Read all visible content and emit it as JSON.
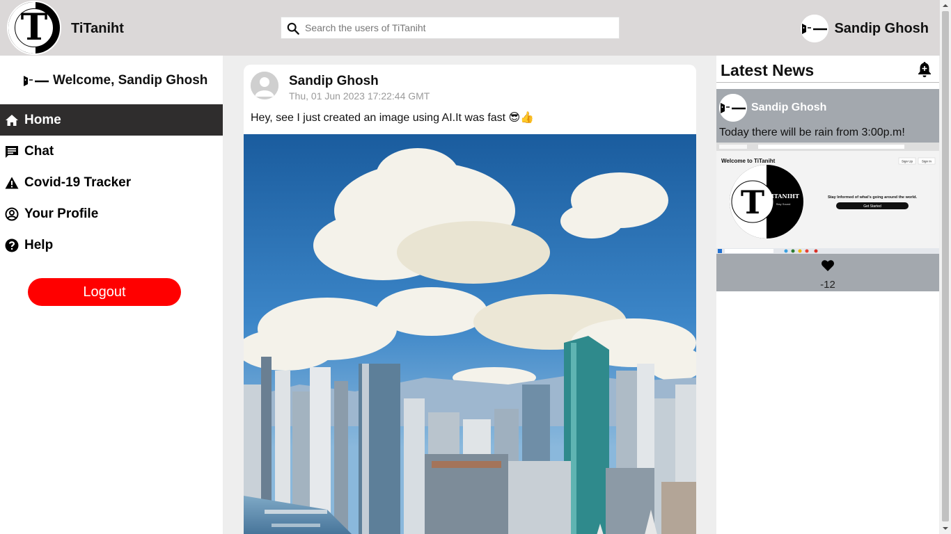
{
  "header": {
    "logo_letter": "T",
    "brand": "TiTaniht",
    "search_placeholder": "Search the users of TiTaniht",
    "user_name": "Sandip Ghosh"
  },
  "sidebar": {
    "welcome": "Welcome, Sandip Ghosh",
    "items": [
      {
        "label": "Home",
        "icon": "home-icon",
        "active": true
      },
      {
        "label": "Chat",
        "icon": "chat-icon",
        "active": false
      },
      {
        "label": "Covid-19 Tracker",
        "icon": "warning-icon",
        "active": false
      },
      {
        "label": "Your Profile",
        "icon": "profile-icon",
        "active": false
      },
      {
        "label": "Help",
        "icon": "help-icon",
        "active": false
      }
    ],
    "logout_label": "Logout"
  },
  "post": {
    "author": "Sandip Ghosh",
    "timestamp": "Thu, 01 Jun 2023 17:22:44 GMT",
    "text": "Hey, see I just created an image using AI.It was fast 😎👍"
  },
  "news": {
    "title": "Latest News",
    "card": {
      "author": "Sandip Ghosh",
      "text": "Today there will be rain from 3:00p.m!",
      "screenshot": {
        "heading": "Welcome to TiTaniht",
        "sign_up": "Sign Up",
        "sign_in": "Sign In",
        "logo_text": "TITANIHT",
        "logo_sub": "Stay Sound",
        "tagline": "Stay Informed of what's going around the world.",
        "cta": "Get Started"
      },
      "likes": "-12"
    }
  },
  "colors": {
    "header_bg": "#dbd8d8",
    "active_nav": "#2f2d2d",
    "logout": "#ff0000",
    "news_card": "#a3a8ae"
  }
}
